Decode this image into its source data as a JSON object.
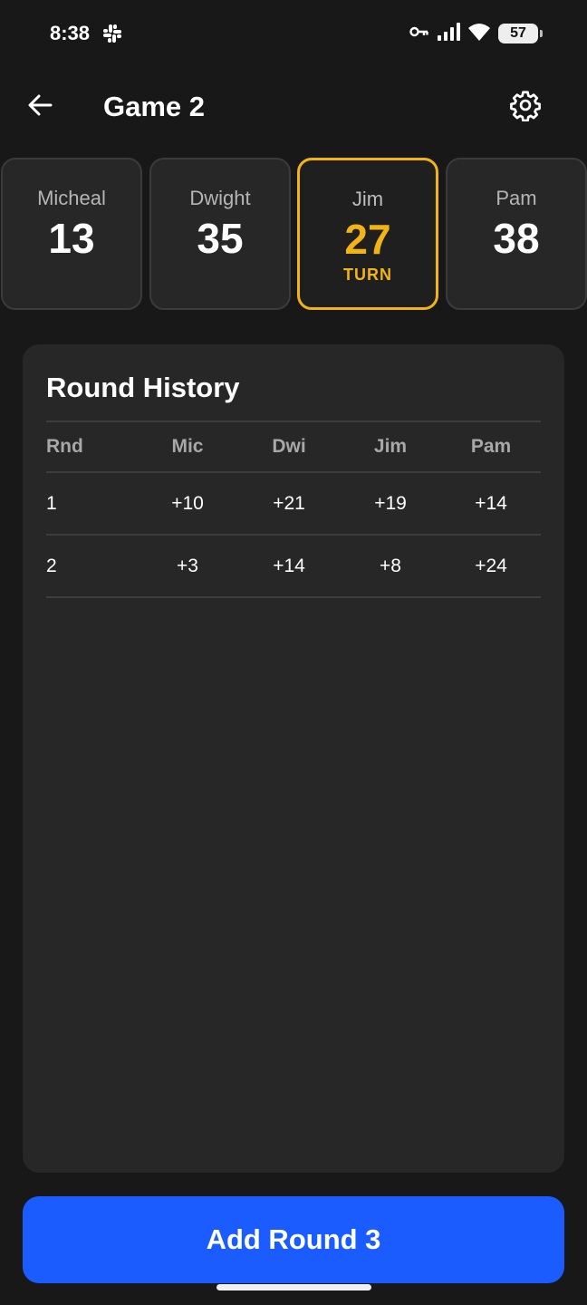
{
  "status_bar": {
    "time": "8:38",
    "battery": "57",
    "icons": [
      "slack-icon",
      "vpn-key-icon",
      "signal-icon",
      "wifi-icon",
      "battery-icon"
    ]
  },
  "header": {
    "title": "Game 2",
    "back_icon": "arrow-left-icon",
    "settings_icon": "gear-icon"
  },
  "players": [
    {
      "name": "Micheal",
      "score": "13",
      "active": false
    },
    {
      "name": "Dwight",
      "score": "35",
      "active": false
    },
    {
      "name": "Jim",
      "score": "27",
      "active": true,
      "badge": "TURN"
    },
    {
      "name": "Pam",
      "score": "38",
      "active": false
    }
  ],
  "history": {
    "title": "Round History",
    "columns": [
      "Rnd",
      "Mic",
      "Dwi",
      "Jim",
      "Pam"
    ],
    "rows": [
      [
        "1",
        "+10",
        "+21",
        "+19",
        "+14"
      ],
      [
        "2",
        "+3",
        "+14",
        "+8",
        "+24"
      ]
    ]
  },
  "actions": {
    "add_round_label": "Add Round 3"
  },
  "colors": {
    "background": "#181818",
    "card": "#272727",
    "accent": "#f2b415",
    "primary_button": "#1a5cff"
  }
}
